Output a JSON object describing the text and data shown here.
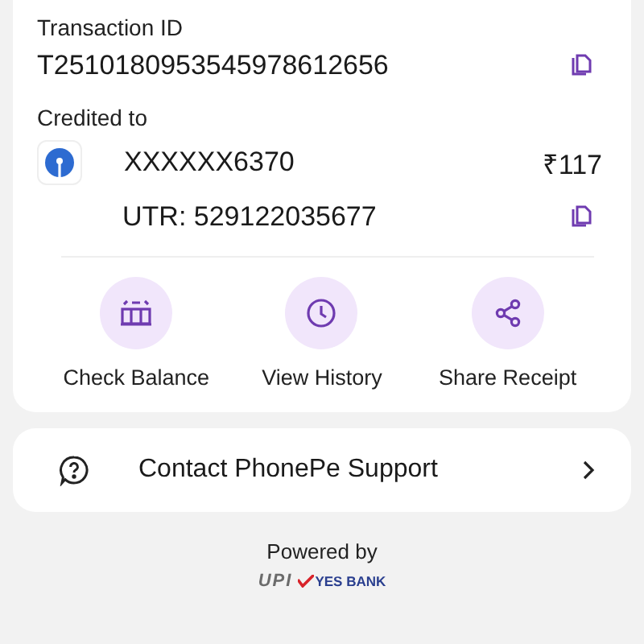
{
  "transaction": {
    "label": "Transaction ID",
    "id": "T2510180953545978612656"
  },
  "credited": {
    "label": "Credited to",
    "account": "XXXXXX6370",
    "amount": "₹117",
    "utr": "UTR: 529122035677"
  },
  "actions": [
    {
      "kind": "balance",
      "label": "Check Balance"
    },
    {
      "kind": "history",
      "label": "View History"
    },
    {
      "kind": "share",
      "label": "Share Receipt"
    }
  ],
  "support": {
    "label": "Contact PhonePe Support"
  },
  "footer": {
    "powered_by": "Powered by",
    "logos": [
      {
        "kind": "upi",
        "text": "UPI"
      },
      {
        "kind": "bank",
        "text": "YES BANK"
      }
    ]
  }
}
